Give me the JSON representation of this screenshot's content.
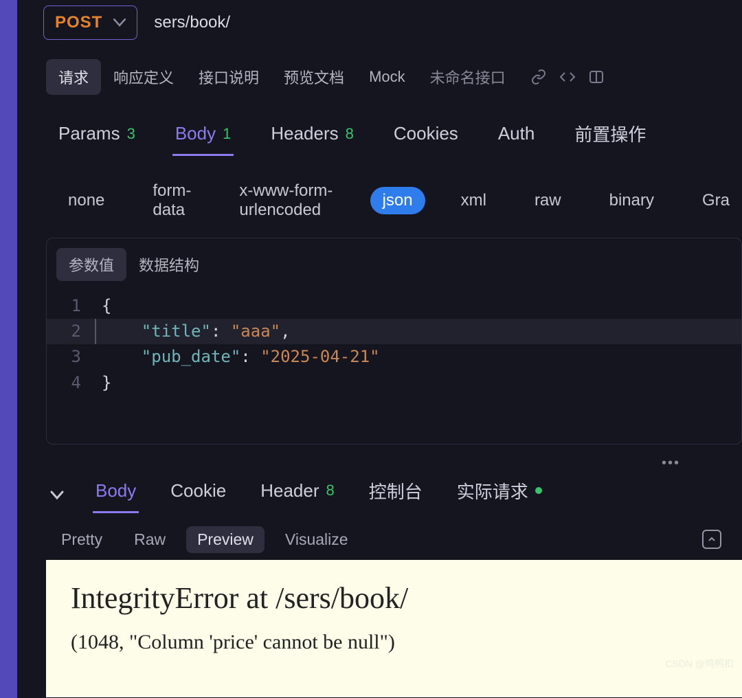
{
  "request": {
    "method": "POST",
    "url": "sers/book/"
  },
  "doc_tabs": {
    "items": [
      "请求",
      "响应定义",
      "接口说明",
      "预览文档",
      "Mock"
    ],
    "unnamed": "未命名接口",
    "active": 0
  },
  "req_tabs": {
    "params": {
      "label": "Params",
      "count": "3"
    },
    "body": {
      "label": "Body",
      "count": "1"
    },
    "headers": {
      "label": "Headers",
      "count": "8"
    },
    "cookies": {
      "label": "Cookies"
    },
    "auth": {
      "label": "Auth"
    },
    "prescript": {
      "label": "前置操作"
    }
  },
  "body_types": [
    "none",
    "form-data",
    "x-www-form-urlencoded",
    "json",
    "xml",
    "raw",
    "binary",
    "Gra"
  ],
  "body_type_active": 3,
  "editor_tabs": {
    "value": "参数值",
    "schema": "数据结构",
    "active": 0
  },
  "code": {
    "lines": [
      {
        "n": "1",
        "raw": "{"
      },
      {
        "n": "2",
        "indent": "    ",
        "key": "\"title\"",
        "val": "\"aaa\"",
        "trail": ","
      },
      {
        "n": "3",
        "indent": "    ",
        "key": "\"pub_date\"",
        "val": "\"2025-04-21\""
      },
      {
        "n": "4",
        "raw": "}"
      }
    ]
  },
  "resp_tabs": {
    "body": {
      "label": "Body"
    },
    "cookie": {
      "label": "Cookie"
    },
    "header": {
      "label": "Header",
      "count": "8"
    },
    "console": {
      "label": "控制台"
    },
    "actual": {
      "label": "实际请求"
    }
  },
  "view_tabs": [
    "Pretty",
    "Raw",
    "Preview",
    "Visualize"
  ],
  "view_active": 2,
  "preview": {
    "title": "IntegrityError at /sers/book/",
    "message": "(1048, \"Column 'price' cannot be null\")"
  },
  "watermark": "CSDN @鸡鸭扣"
}
